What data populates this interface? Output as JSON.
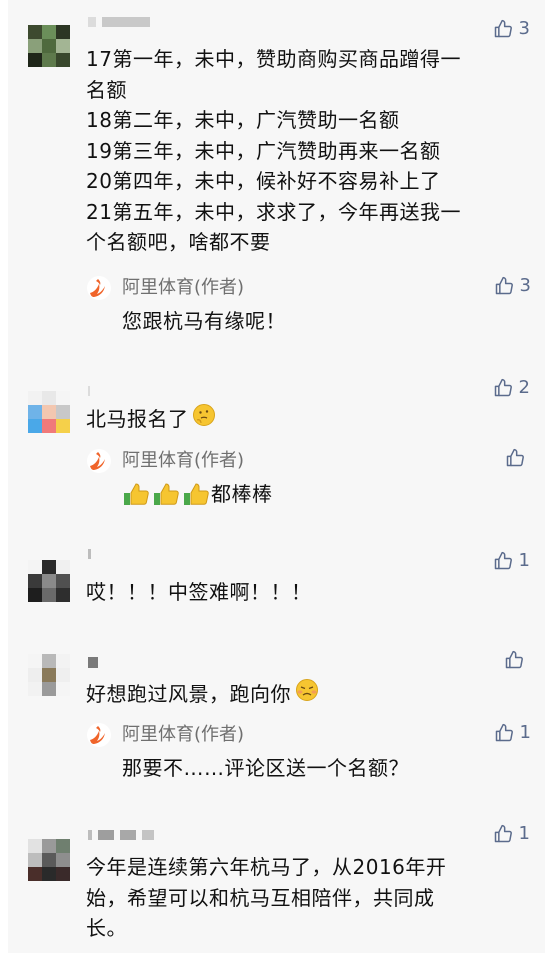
{
  "comments": [
    {
      "likes": "3",
      "lines": [
        "17第一年，未中，赞助商购买商品蹭得一",
        "名额",
        "18第二年，未中，广汽赞助一名额",
        "19第三年，未中，广汽赞助再来一名额",
        "20第四年，未中，候补好不容易补上了",
        "21第五年，未中，求求了，今年再送我一",
        "个名额吧，啥都不要"
      ],
      "reply": {
        "author": "阿里体育(作者)",
        "text": "您跟杭马有缘呢！",
        "likes": "3"
      }
    },
    {
      "likes": "2",
      "lines": [
        "北马报名了"
      ],
      "emoji": "thinking-face",
      "reply": {
        "author": "阿里体育(作者)",
        "text": "都棒棒",
        "emoji": "thumbs-up-x3",
        "likes": ""
      }
    },
    {
      "likes": "1",
      "lines": [
        "哎！！！中签难啊！！！"
      ]
    },
    {
      "likes": "",
      "lines": [
        "好想跑过风景，跑向你"
      ],
      "emoji": "worried-face",
      "reply": {
        "author": "阿里体育(作者)",
        "text": "那要不……评论区送一个名额？",
        "likes": "1"
      }
    },
    {
      "likes": "1",
      "lines": [
        "今年是连续第六年杭马了，从2016年开",
        "始，希望可以和杭马互相陪伴，共同成",
        "长。"
      ]
    }
  ],
  "colors": {
    "background": "#f7f7f7",
    "like": "#5b6b8c",
    "author": "#6f6f6f",
    "logo": "#f0642a"
  }
}
